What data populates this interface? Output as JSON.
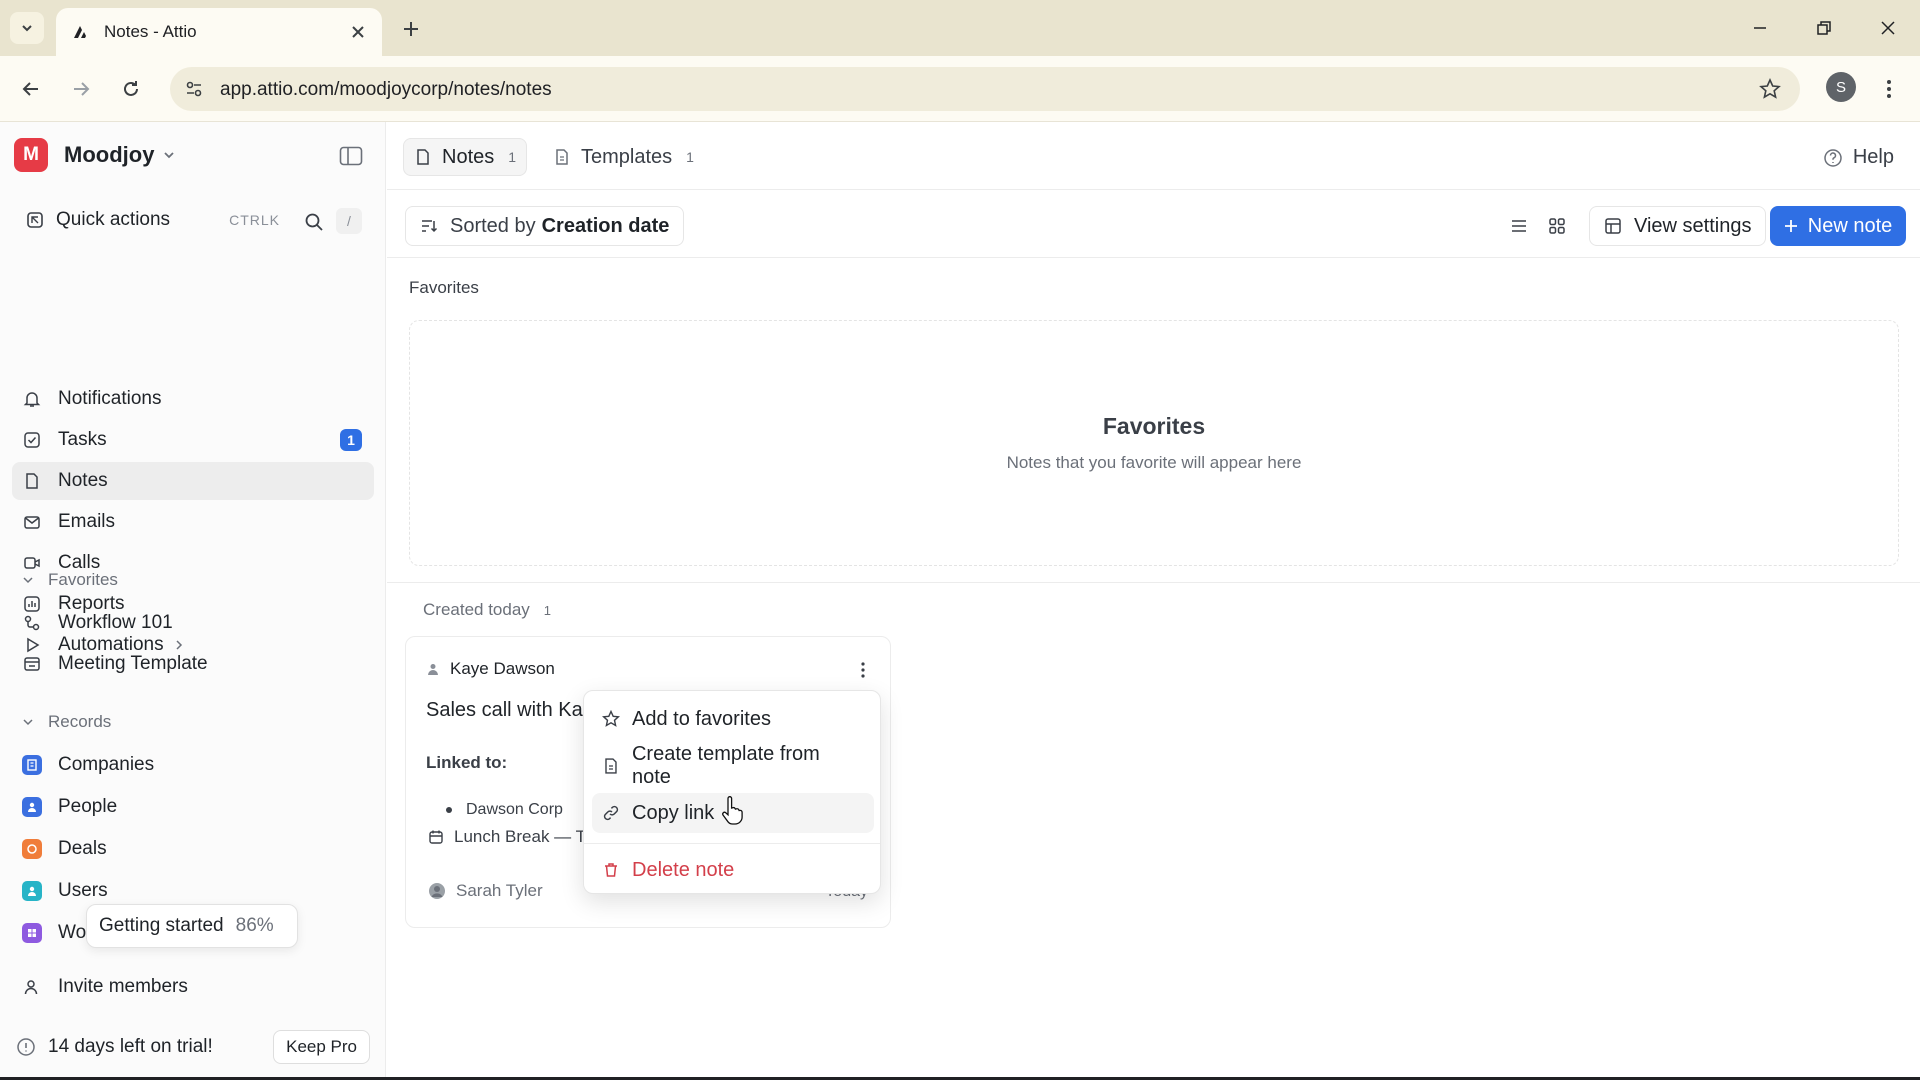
{
  "browser": {
    "tab_title": "Notes - Attio",
    "url": "app.attio.com/moodjoycorp/notes/notes",
    "profile_initial": "S"
  },
  "sidebar": {
    "workspace": "Moodjoy",
    "workspace_initial": "M",
    "quick_actions": "Quick actions",
    "quick_actions_kbd": "CTRLK",
    "search_shortcut": "/",
    "nav": [
      {
        "label": "Notifications",
        "icon": "bell-icon"
      },
      {
        "label": "Tasks",
        "icon": "check-square-icon",
        "badge": "1"
      },
      {
        "label": "Notes",
        "icon": "document-icon",
        "active": true
      },
      {
        "label": "Emails",
        "icon": "mail-icon"
      },
      {
        "label": "Calls",
        "icon": "video-icon"
      },
      {
        "label": "Reports",
        "icon": "chart-icon"
      },
      {
        "label": "Automations",
        "icon": "play-icon"
      }
    ],
    "favorites_header": "Favorites",
    "favorites": [
      {
        "label": "Workflow 101",
        "icon": "workflow-icon"
      },
      {
        "label": "Meeting Template",
        "icon": "template-icon"
      }
    ],
    "records_header": "Records",
    "records": [
      {
        "label": "Companies",
        "color": "#3b6fe0"
      },
      {
        "label": "People",
        "color": "#3b6fe0"
      },
      {
        "label": "Deals",
        "color": "#f07d3a"
      },
      {
        "label": "Users",
        "color": "#27b4c7"
      },
      {
        "label": "Wor",
        "color": "#8e5ae0"
      }
    ],
    "getting_started": "Getting started",
    "getting_started_pct": "86%",
    "invite": "Invite members",
    "trial": "14 days left on trial!",
    "keep_pro": "Keep Pro"
  },
  "main": {
    "tabs": [
      {
        "label": "Notes",
        "count": "1",
        "active": true
      },
      {
        "label": "Templates",
        "count": "1",
        "active": false
      }
    ],
    "help": "Help",
    "sort_prefix": "Sorted by",
    "sort_value": "Creation date",
    "view_settings": "View settings",
    "new_note": "New note",
    "favorites_label": "Favorites",
    "favorites_empty_title": "Favorites",
    "favorites_empty_sub": "Notes that you favorite will appear here",
    "created_label": "Created today",
    "created_count": "1",
    "card": {
      "author": "Kaye Dawson",
      "title": "Sales call with Ka",
      "linked_label": "Linked to:",
      "linked_item": "Dawson Corp",
      "event": "Lunch Break — T",
      "footer_user": "Sarah Tyler",
      "date": "Today"
    },
    "context_menu": [
      {
        "label": "Add to favorites",
        "icon": "star-icon"
      },
      {
        "label": "Create template from note",
        "icon": "template-icon"
      },
      {
        "label": "Copy link",
        "icon": "link-icon"
      },
      {
        "label": "Delete note",
        "icon": "trash-icon"
      }
    ],
    "colors": {
      "accent": "#2f6fe4",
      "danger": "#d33f4a",
      "workspace": "#e63b46"
    }
  }
}
